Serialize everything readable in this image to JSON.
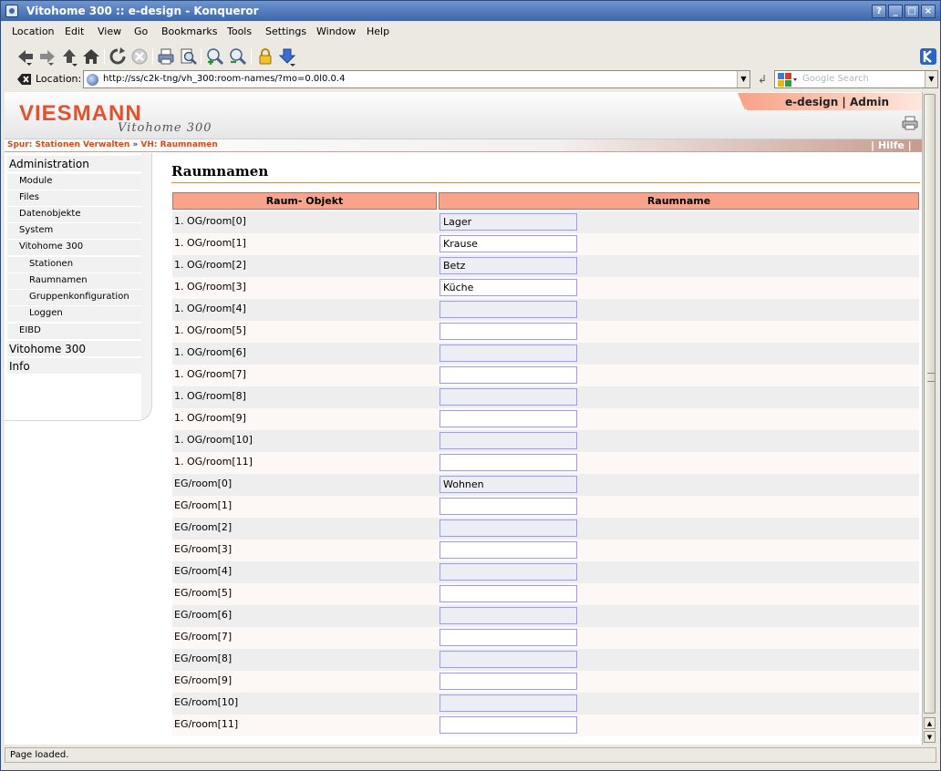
{
  "window": {
    "title": "Vitohome 300 :: e-design - Konqueror",
    "buttons": [
      "?",
      "_",
      "□",
      "×"
    ]
  },
  "menu": [
    {
      "label": "Location"
    },
    {
      "label": "Edit"
    },
    {
      "label": "View"
    },
    {
      "label": "Go"
    },
    {
      "label": "Bookmarks"
    },
    {
      "label": "Tools"
    },
    {
      "label": "Settings"
    },
    {
      "label": "Window"
    },
    {
      "label": "Help"
    }
  ],
  "toolbar": {
    "icons": [
      "back-icon",
      "forward-icon",
      "up-icon",
      "home-icon",
      "reload-icon",
      "stop-icon",
      "print-icon",
      "print-preview-icon",
      "zoom-in-icon",
      "zoom-out-icon",
      "lock-icon",
      "download-icon"
    ]
  },
  "location": {
    "label": "Location:",
    "url": "http://ss/c2k-tng/vh_300:room-names/?mo=0.0l0.0.4",
    "search_placeholder": "Google Search"
  },
  "header": {
    "brand": "VIESMANN",
    "product": "Vitohome 300",
    "user": "e-design | Admin"
  },
  "trail": {
    "prefix": "Spur:",
    "items": [
      "Stationen Verwalten",
      "VH: Raumnamen"
    ],
    "separator": "»",
    "help": "| Hilfe |"
  },
  "sidebar": {
    "items": [
      {
        "label": "Administration",
        "level": 0
      },
      {
        "label": "Module",
        "level": 1
      },
      {
        "label": "Files",
        "level": 1
      },
      {
        "label": "Datenobjekte",
        "level": 1
      },
      {
        "label": "System",
        "level": 1
      },
      {
        "label": "Vitohome 300",
        "level": 1
      },
      {
        "label": "Stationen",
        "level": 2
      },
      {
        "label": "Raumnamen",
        "level": 2
      },
      {
        "label": "Gruppenkonfiguration",
        "level": 2
      },
      {
        "label": "Loggen",
        "level": 2
      },
      {
        "label": "EIBD",
        "level": 1
      },
      {
        "label": "Vitohome 300",
        "level": 0
      },
      {
        "label": "Info",
        "level": 0
      }
    ]
  },
  "main": {
    "title": "Raumnamen",
    "columns": [
      "Raum- Objekt",
      "Raumname"
    ],
    "rows": [
      {
        "object": "1. OG/room[0]",
        "name": "Lager"
      },
      {
        "object": "1. OG/room[1]",
        "name": "Krause"
      },
      {
        "object": "1. OG/room[2]",
        "name": "Betz"
      },
      {
        "object": "1. OG/room[3]",
        "name": "Küche"
      },
      {
        "object": "1. OG/room[4]",
        "name": ""
      },
      {
        "object": "1. OG/room[5]",
        "name": ""
      },
      {
        "object": "1. OG/room[6]",
        "name": ""
      },
      {
        "object": "1. OG/room[7]",
        "name": ""
      },
      {
        "object": "1. OG/room[8]",
        "name": ""
      },
      {
        "object": "1. OG/room[9]",
        "name": ""
      },
      {
        "object": "1. OG/room[10]",
        "name": ""
      },
      {
        "object": "1. OG/room[11]",
        "name": ""
      },
      {
        "object": "EG/room[0]",
        "name": "Wohnen"
      },
      {
        "object": "EG/room[1]",
        "name": ""
      },
      {
        "object": "EG/room[2]",
        "name": ""
      },
      {
        "object": "EG/room[3]",
        "name": ""
      },
      {
        "object": "EG/room[4]",
        "name": ""
      },
      {
        "object": "EG/room[5]",
        "name": ""
      },
      {
        "object": "EG/room[6]",
        "name": ""
      },
      {
        "object": "EG/room[7]",
        "name": ""
      },
      {
        "object": "EG/room[8]",
        "name": ""
      },
      {
        "object": "EG/room[9]",
        "name": ""
      },
      {
        "object": "EG/room[10]",
        "name": ""
      },
      {
        "object": "EG/room[11]",
        "name": ""
      }
    ]
  },
  "status": {
    "text": "Page loaded."
  },
  "colors": {
    "accent": "#f8a48a",
    "trail_text": "#d84a1b",
    "brand": "#e5512d"
  }
}
